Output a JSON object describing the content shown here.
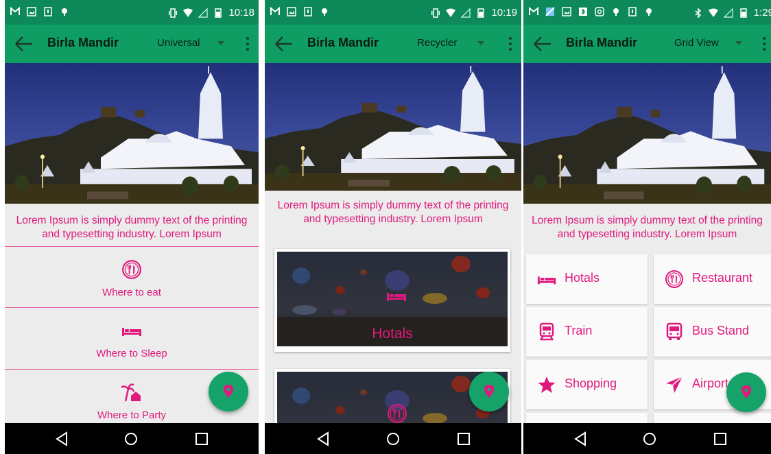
{
  "status_time": [
    "10:18",
    "10:19",
    "1:29"
  ],
  "appbar": {
    "title": "Birla Mandir"
  },
  "spinners": [
    "Universal",
    "Recycler",
    "Grid View"
  ],
  "description": {
    "line1": "Lorem Ipsum is simply dummy text of the printing",
    "line2": "and typesetting industry. Lorem Ipsum",
    "line1_clipped": "Lorem Ipsum is simply dummy text of the printing"
  },
  "list_items": [
    {
      "label": "Where to eat",
      "icon": "restaurant-icon"
    },
    {
      "label": "Where to Sleep",
      "icon": "hotel-icon"
    },
    {
      "label": "Where to Party",
      "icon": "beach-party-icon"
    }
  ],
  "cards": [
    {
      "label": "Hotals",
      "icon": "hotel-icon"
    },
    {
      "label": "",
      "icon": "restaurant-icon"
    }
  ],
  "grid_items": [
    {
      "label": "Hotals",
      "icon": "hotel-icon"
    },
    {
      "label": "Restaurant",
      "icon": "restaurant-icon"
    },
    {
      "label": "Train",
      "icon": "train-icon"
    },
    {
      "label": "Bus Stand",
      "icon": "bus-icon"
    },
    {
      "label": "Shopping",
      "icon": "star-icon"
    },
    {
      "label": "Airport",
      "icon": "airplane-icon"
    }
  ],
  "colors": {
    "primary": "#0f9d63",
    "status": "#0e8a5a",
    "accent": "#e0197d",
    "fab": "#16a36a"
  }
}
